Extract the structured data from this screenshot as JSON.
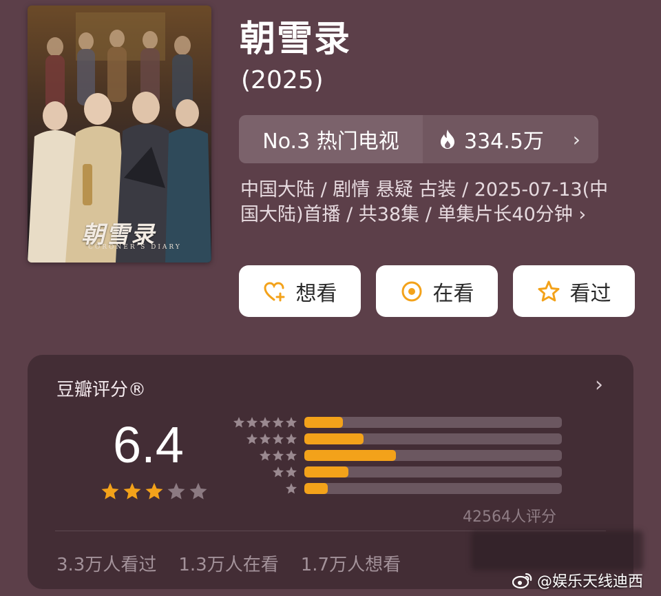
{
  "show": {
    "title": "朝雪录",
    "year": "(2025)",
    "poster": {
      "title_art": "朝雪录",
      "subtitle_art": "CORONER'S DIARY"
    }
  },
  "rank": {
    "label": "No.3 热门电视",
    "heat": "334.5万",
    "heat_icon": "flame-icon"
  },
  "meta": {
    "line": "中国大陆 / 剧情 悬疑 古装 / 2025-07-13(中国大陆)首播 / 共38集 / 单集片长40分钟 ›"
  },
  "actions": [
    {
      "label": "想看",
      "icon": "heart-plus-icon"
    },
    {
      "label": "在看",
      "icon": "target-icon"
    },
    {
      "label": "看过",
      "icon": "star-outline-icon"
    }
  ],
  "rating": {
    "title": "豆瓣评分®",
    "score": "6.4",
    "stars": 3,
    "distribution": [
      {
        "stars": 5,
        "fraction": 0.15
      },
      {
        "stars": 4,
        "fraction": 0.23
      },
      {
        "stars": 3,
        "fraction": 0.355
      },
      {
        "stars": 2,
        "fraction": 0.17
      },
      {
        "stars": 1,
        "fraction": 0.09
      }
    ],
    "count": "42564人评分",
    "stats": {
      "watched": "3.3万人看过",
      "watching": "1.3万人在看",
      "want": "1.7万人想看"
    }
  },
  "watermark": "@娱乐天线迪西",
  "colors": {
    "background": "#5c3f49",
    "card": "#432d35",
    "accent": "#f3a21a"
  }
}
